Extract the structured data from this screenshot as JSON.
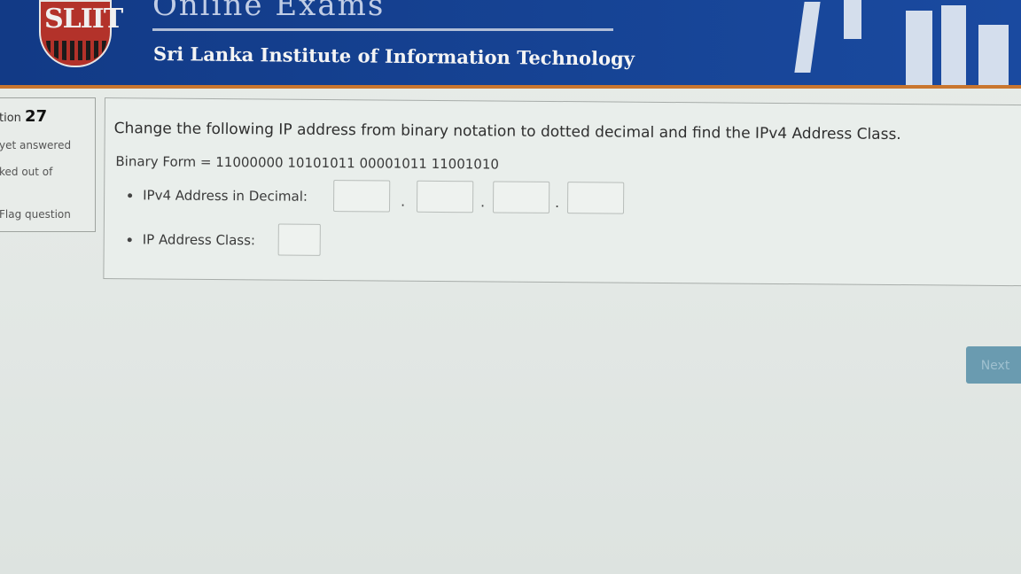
{
  "header": {
    "logo_text": "SLIIT",
    "top_text": "Online Exams",
    "institute_name": "Sri Lanka Institute of Information Technology"
  },
  "question_info": {
    "label_prefix": "tion",
    "number": "27",
    "status": "yet answered",
    "marked": "ked out of",
    "flag": "Flag question"
  },
  "question": {
    "prompt": "Change the following IP address from binary notation to dotted decimal and find the IPv4 Address Class.",
    "binary": "Binary Form = 11000000 10101011 00001011 11001010",
    "decimal_label": "IPv4 Address in Decimal:",
    "class_label": "IP Address Class:",
    "separator": "."
  },
  "nav": {
    "next_label": "Next"
  }
}
